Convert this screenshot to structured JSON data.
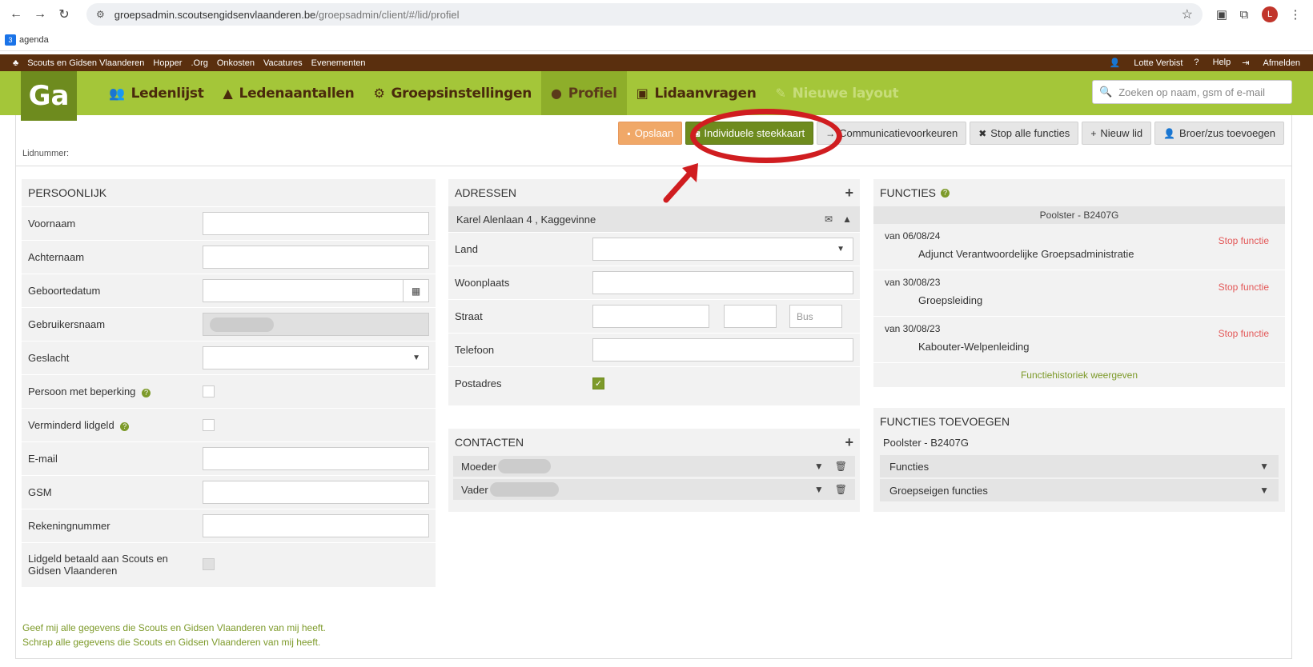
{
  "browser": {
    "url_host": "groepsadmin.scoutsengidsenvlaanderen.be",
    "url_path": "/groepsadmin/client/#/lid/profiel",
    "bookmark": "agenda",
    "profile_initial": "L"
  },
  "topbar": {
    "links": [
      "Scouts en Gidsen Vlaanderen",
      "Hopper",
      ".Org",
      "Onkosten",
      "Vacatures",
      "Evenementen"
    ],
    "user": "Lotte Verbist",
    "help": "Help",
    "logout": "Afmelden"
  },
  "nav": {
    "logo": "Ga",
    "items": [
      {
        "label": "Ledenlijst",
        "icon": "users-icon"
      },
      {
        "label": "Ledenaantallen",
        "icon": "chart-icon"
      },
      {
        "label": "Groepsinstellingen",
        "icon": "gears-icon"
      },
      {
        "label": "Profiel",
        "icon": "user-icon"
      },
      {
        "label": "Lidaanvragen",
        "icon": "id-card-icon"
      },
      {
        "label": "Nieuwe layout",
        "icon": "edit-icon"
      }
    ],
    "search_placeholder": "Zoeken op naam, gsm of e-mail"
  },
  "actions": {
    "save": "Opslaan",
    "card": "Individuele steekkaart",
    "comm": "Communicatievoorkeuren",
    "stop_all": "Stop alle functies",
    "new_member": "Nieuw lid",
    "sibling": "Broer/zus toevoegen"
  },
  "lidnummer_label": "Lidnummer:",
  "persoonlijk": {
    "title": "PERSOONLIJK",
    "fields": {
      "voornaam": "Voornaam",
      "achternaam": "Achternaam",
      "geboortedatum": "Geboortedatum",
      "gebruikersnaam": "Gebruikersnaam",
      "geslacht": "Geslacht",
      "beperking": "Persoon met beperking",
      "verminderd": "Verminderd lidgeld",
      "email": "E-mail",
      "gsm": "GSM",
      "rekening": "Rekeningnummer",
      "lidgeld": "Lidgeld betaald aan Scouts en Gidsen Vlaanderen"
    }
  },
  "adressen": {
    "title": "ADRESSEN",
    "address": "Karel Alenlaan 4 , Kaggevinne",
    "land": "Land",
    "woonplaats": "Woonplaats",
    "straat": "Straat",
    "bus_placeholder": "Bus",
    "telefoon": "Telefoon",
    "postadres": "Postadres"
  },
  "contacten": {
    "title": "CONTACTEN",
    "items": [
      "Moeder",
      "Vader"
    ]
  },
  "functies": {
    "title": "FUNCTIES",
    "group": "Poolster - B2407G",
    "items": [
      {
        "date": "van 06/08/24",
        "name": "Adjunct Verantwoordelijke Groepsadministratie",
        "stop": "Stop functie"
      },
      {
        "date": "van 30/08/23",
        "name": "Groepsleiding",
        "stop": "Stop functie"
      },
      {
        "date": "van 30/08/23",
        "name": "Kabouter-Welpenleiding",
        "stop": "Stop functie"
      }
    ],
    "history": "Functiehistoriek weergeven"
  },
  "functies_toevoegen": {
    "title": "FUNCTIES TOEVOEGEN",
    "group": "Poolster - B2407G",
    "functies": "Functies",
    "groepseigen": "Groepseigen functies"
  },
  "footer": {
    "link1": "Geef mij alle gegevens die Scouts en Gidsen Vlaanderen van mij heeft.",
    "link2": "Schrap alle gegevens die Scouts en Gidsen Vlaanderen van mij heeft."
  },
  "colors": {
    "brown": "#5a2f0e",
    "green": "#a4c639",
    "dark_green": "#6e8b1e",
    "red_highlight": "#d01d20"
  }
}
